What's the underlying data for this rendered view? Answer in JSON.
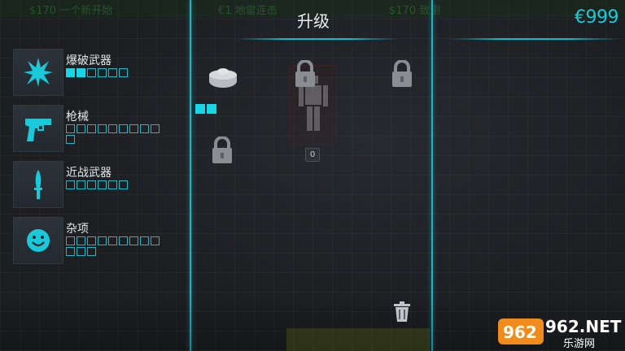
{
  "screen_title": "升级",
  "currency": "€999",
  "background_topbar": {
    "item1": "$170 一个新开始",
    "item2": "€1 地雷连击",
    "item3": "$170 致谢"
  },
  "categories": [
    {
      "label": "爆破武器",
      "icon": "explosion-icon",
      "filled": 2,
      "total": 6
    },
    {
      "label": "枪械",
      "icon": "pistol-icon",
      "filled": 0,
      "total": 10
    },
    {
      "label": "近战武器",
      "icon": "knife-icon",
      "filled": 0,
      "total": 6
    },
    {
      "label": "杂项",
      "icon": "smiley-icon",
      "filled": 0,
      "total": 12
    }
  ],
  "grid": {
    "item_count": "0",
    "owned_level": 2
  },
  "colors": {
    "accent": "#18b6c6",
    "highlight": "#19d6e6",
    "lock": "#8a8e92"
  },
  "watermark": {
    "brand": "962.NET",
    "sub": "乐游网"
  }
}
